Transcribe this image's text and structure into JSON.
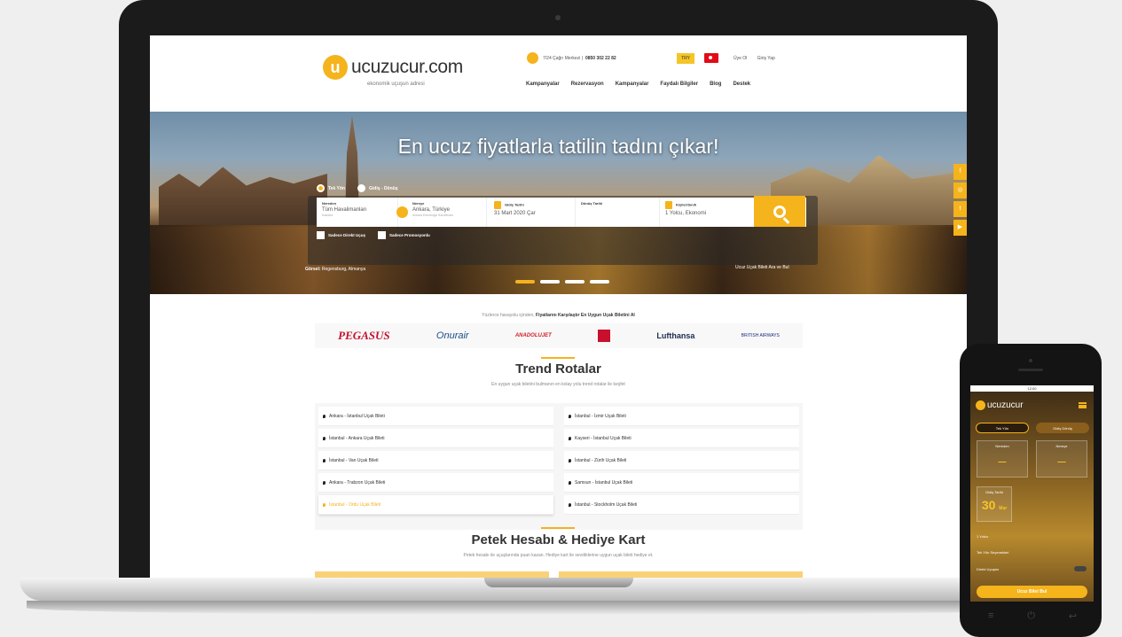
{
  "header": {
    "logo_text": "ucuzucur.com",
    "logo_tagline": "ekonomik uçuşun adresi",
    "callcenter_label": "7/24 Çağrı Merkezi |",
    "callcenter_phone": "0850 302 22 82",
    "currency": "TRY",
    "auth": [
      "Üye Ol",
      "Giriş Yap"
    ],
    "nav": [
      "Kampanyalar",
      "Rezervasyon",
      "Kampanyalar",
      "Faydalı Bilgiler",
      "Blog",
      "Destek"
    ]
  },
  "hero": {
    "title": "En ucuz fiyatlarla tatilin tadını çıkar!",
    "trip_types": [
      "Tek Yön",
      "Gidiş - Dönüş"
    ],
    "search": {
      "from_label": "Nereden",
      "from_value": "Tüm Havalimanları",
      "from_sub": "İstanbul",
      "to_label": "Nereye",
      "to_value": "Ankara, Türkiye",
      "to_sub": "Ankara Esenboğa Havalimanı",
      "depart_label": "Gidiş Tarihi",
      "depart_value": "31 Mart 2020 Çar",
      "return_label": "Dönüş Tarihi",
      "return_value": "",
      "pax_label": "Kişiler/Sınıfı",
      "pax_value": "1 Yolcu, Ekonomi"
    },
    "options": [
      "Sadece Direkt Uçuş",
      "Sadece Promosyonlu"
    ],
    "photo_credit_label": "Görsel:",
    "photo_credit_place": "Regensburg, Almanya",
    "cheap_link": "Ucuz Uçak Bileti Ara ve Bul",
    "social_icons": [
      "facebook-icon",
      "instagram-icon",
      "twitter-icon",
      "youtube-icon"
    ]
  },
  "airlines_intro_pre": "Yüzlerce havayolu içinden,",
  "airlines_intro_bold": "Fiyatlarını Karşılaştır En Uygun Uçak Biletini Al",
  "airlines": [
    "PEGASUS",
    "Onurair",
    "ANADOLUJET",
    "Turkish Airlines",
    "Lufthansa",
    "BRITISH AIRWAYS"
  ],
  "trend": {
    "title": "Trend Rotalar",
    "subtitle": "En uygun uçak biletini bulmanın en kolay yolu trend rotalar ile keşfet",
    "left": [
      "Ankara - İstanbul Uçak Bileti",
      "İstanbul - Ankara Uçak Bileti",
      "İstanbul - Van Uçak Bileti",
      "Ankara - Trabzon Uçak Bileti",
      "İstanbul - Ordu Uçak Bileti"
    ],
    "right": [
      "İstanbul - İzmir Uçak Bileti",
      "Kayseri - İstanbul Uçak Bileti",
      "İstanbul - Zürih Uçak Bileti",
      "Samsun - İstanbul Uçak Bileti",
      "İstanbul - Stockholm Uçak Bileti"
    ]
  },
  "petek": {
    "title": "Petek Hesabı & Hediye Kart",
    "subtitle": "Petek hesabı ile uçuşlarında puan kazan. Hediye kart ile sevdiklerine uygun uçak bileti hediye et."
  },
  "phone": {
    "status_time": "12:00",
    "logo_text": "ucuzucur",
    "tabs": [
      "Tek Yön",
      "Gidiş Dönüş"
    ],
    "from_label": "Nereden",
    "from_value": "—",
    "to_label": "Nereye",
    "to_value": "—",
    "date_label": "Gidiş Tarihi",
    "date_day": "30",
    "date_month": "Mar",
    "pax": "1 Yolcu",
    "opt1": "Tek Yön Seçenekleri",
    "opt2": "Direkt Uçuşlar",
    "search_button": "Ucuz Bilet Bul"
  },
  "colors": {
    "accent": "#f5b31c",
    "text": "#333333"
  }
}
